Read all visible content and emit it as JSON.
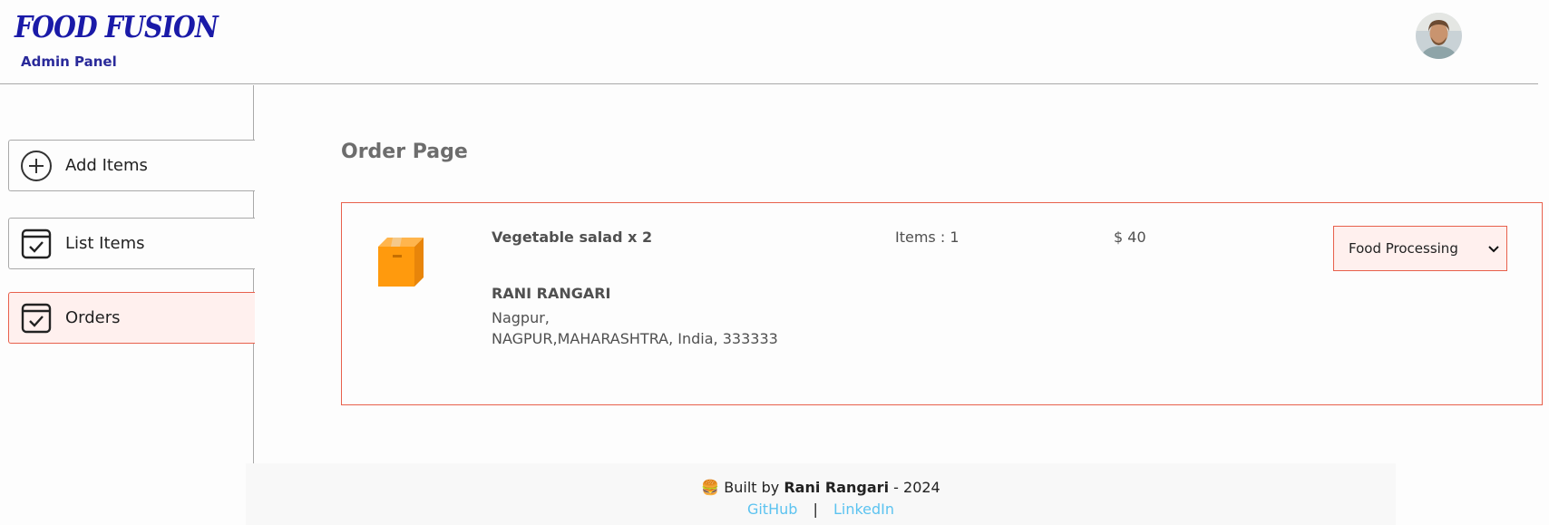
{
  "header": {
    "logo_text": "FOOD FUSION",
    "subtitle": "Admin Panel",
    "avatar_icon": "user-avatar"
  },
  "sidebar": {
    "items": [
      {
        "label": "Add Items",
        "icon": "plus-circle-icon",
        "active": false
      },
      {
        "label": "List Items",
        "icon": "checkbox-icon",
        "active": false
      },
      {
        "label": "Orders",
        "icon": "checkbox-icon",
        "active": true
      }
    ]
  },
  "main": {
    "title": "Order Page",
    "orders": [
      {
        "icon": "parcel-icon",
        "item_summary": "Vegetable salad x 2",
        "customer_name": "RANI RANGARI",
        "address_line1": "Nagpur,",
        "address_line2": "NAGPUR,MAHARASHTRA, India, 333333",
        "items_count": "Items : 1",
        "amount": "$ 40",
        "status": "Food Processing"
      }
    ]
  },
  "footer": {
    "emoji": "🍔",
    "built_by_prefix": "Built by",
    "author": "Rani Rangari",
    "year_suffix": "- 2024",
    "links": [
      "GitHub",
      "LinkedIn"
    ],
    "separator": "|"
  },
  "colors": {
    "accent": "#e8604c",
    "active_bg": "#fff0ee",
    "logo": "#1a1aa8",
    "link": "#5cc3f0"
  }
}
